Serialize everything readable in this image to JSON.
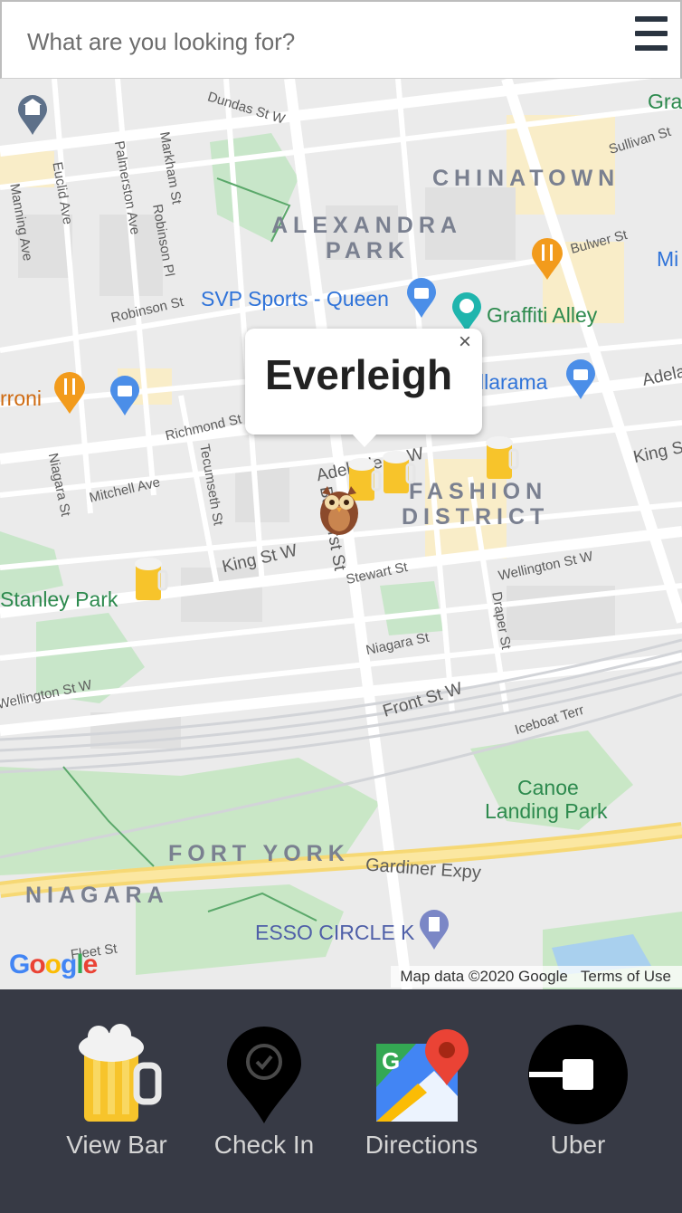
{
  "search": {
    "placeholder": "What are you looking for?"
  },
  "menu": {
    "icon": "hamburger-menu-icon"
  },
  "map": {
    "streets": [
      "Dundas St W",
      "Sullivan St",
      "Bulwer St",
      "Euclid Ave",
      "Palmerston Ave",
      "Markham St",
      "Robinson Pl",
      "Manning Ave",
      "Robinson St",
      "Richmond St",
      "Tecumseth St",
      "Mitchell Ave",
      "Niagara St",
      "Bathurst St",
      "Adelaide St W",
      "King St W",
      "Stewart St",
      "Wellington St W",
      "Wellington St W",
      "Niagara St",
      "Draper St",
      "Front St W",
      "Iceboat Terr",
      "Gardiner Expy",
      "Fleet St",
      "Adela",
      "King St"
    ],
    "districts": [
      "CHINATOWN",
      "ALEXANDRA",
      "PARK",
      "FASHION",
      "DISTRICT",
      "FORT YORK",
      "NIAGARA"
    ],
    "pois": {
      "svp": "SVP Sports - Queen",
      "graffiti": "Graffiti Alley",
      "illarama": "llarama",
      "peroni": "rroni",
      "stanley": "Stanley Park",
      "canoe1": "Canoe",
      "canoe2": "Landing Park",
      "esso": "ESSO CIRCLE K",
      "gra": "Gra",
      "mi": "Mi"
    },
    "info_window": {
      "title": "Everleigh",
      "close": "×"
    },
    "google_logo": "Google",
    "attribution": {
      "data": "Map data ©2020 Google",
      "terms": "Terms of Use"
    },
    "colors": {
      "beer": "#f7c42b",
      "poi_blue": "#2f73d9",
      "restaurant": "#f29b1c",
      "park": "#c7e6c5"
    }
  },
  "actions": [
    {
      "label": "View Bar",
      "icon": "beer-mug-icon"
    },
    {
      "label": "Check In",
      "icon": "check-in-pin-icon"
    },
    {
      "label": "Directions",
      "icon": "google-maps-icon"
    },
    {
      "label": "Uber",
      "icon": "uber-logo-icon"
    }
  ],
  "colors": {
    "action_bar_bg": "#373a45",
    "action_label": "#d4d4d4"
  }
}
